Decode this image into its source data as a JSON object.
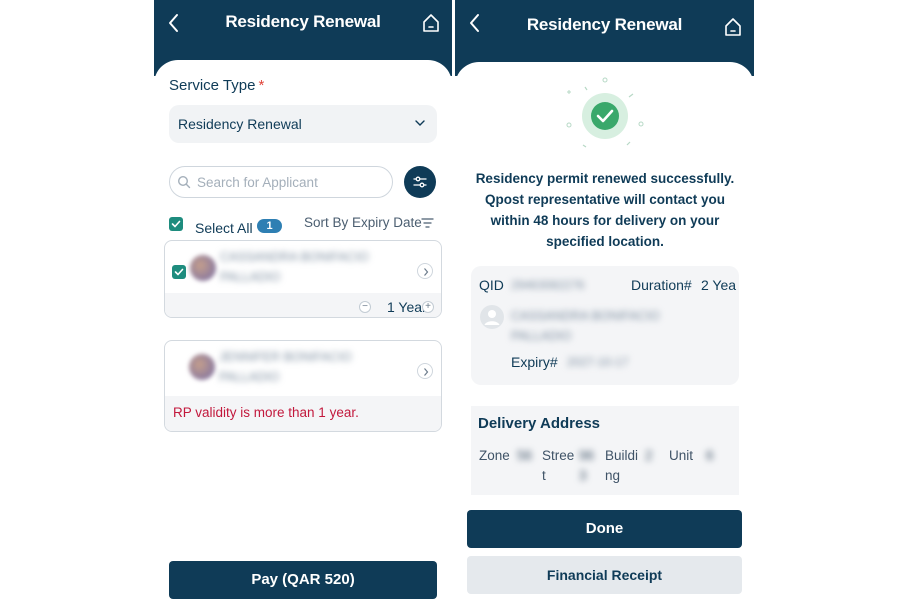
{
  "colors": {
    "primary": "#0f3b57",
    "accent_green": "#1e8c7e",
    "success_green": "#3aa86b",
    "error": "#c2183c"
  },
  "left": {
    "header": {
      "title": "Residency Renewal",
      "back_icon": "chevron-left-icon",
      "home_icon": "home-icon"
    },
    "service_type": {
      "label": "Service Type",
      "required_mark": "*",
      "value": "Residency Renewal"
    },
    "search": {
      "placeholder": "Search for Applicant"
    },
    "select_all": {
      "label": "Select All",
      "count": "1",
      "checked": true
    },
    "sort": {
      "label": "Sort By Expiry Date"
    },
    "applicants": [
      {
        "name_line1": "CASSANDRA BONIFACIO",
        "name_line2": "PALLADIO",
        "checked": true,
        "duration": "1 Year"
      },
      {
        "name_line1": "JENNIFER BONIFACIO",
        "name_line2": "PALLADIO",
        "warning": "RP validity is more than 1 year."
      }
    ],
    "pay_button": "Pay (QAR 520)"
  },
  "right": {
    "header": {
      "title": "Residency Renewal",
      "back_icon": "chevron-left-icon",
      "home_icon": "home-icon"
    },
    "success_message": "Residency permit renewed successfully. Qpost representative will contact you within 48 hours for delivery on your specified location.",
    "permit": {
      "qid_label": "QID",
      "qid_value": "29463082276",
      "duration_label": "Duration#",
      "duration_value": "2 Yea",
      "name_line1": "CASSANDRA BONIFACIO",
      "name_line2": "PALLADIO",
      "expiry_label": "Expiry#",
      "expiry_value": "2027-10-17"
    },
    "delivery": {
      "title": "Delivery Address",
      "zone_label": "Zone",
      "zone_value": "56",
      "street_label_1": "Stree",
      "street_label_2": "t",
      "street_value_1": "96",
      "street_value_2": "3",
      "building_label_1": "Buildi",
      "building_label_2": "ng",
      "building_value": "2",
      "unit_label": "Unit",
      "unit_value": "6"
    },
    "done_button": "Done",
    "receipt_button": "Financial Receipt"
  }
}
